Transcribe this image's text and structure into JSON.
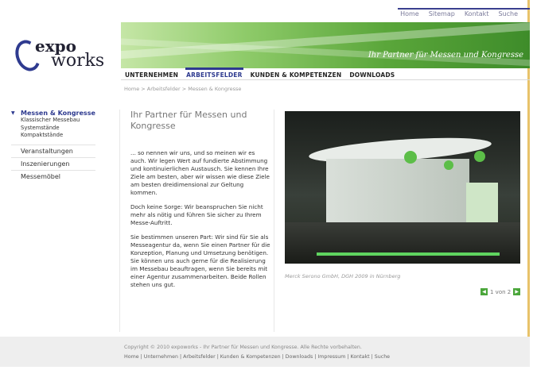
{
  "utility_nav": [
    "Home",
    "Sitemap",
    "Kontakt",
    "Suche"
  ],
  "logo": {
    "word1": "expo",
    "word2": "works"
  },
  "banner": {
    "slogan": "Ihr Partner für Messen und Kongresse"
  },
  "main_nav": [
    {
      "label": "UNTERNEHMEN",
      "active": false
    },
    {
      "label": "ARBEITSFELDER",
      "active": true
    },
    {
      "label": "KUNDEN & KOMPETENZEN",
      "active": false
    },
    {
      "label": "DOWNLOADS",
      "active": false
    }
  ],
  "breadcrumb": "Home > Arbeitsfelder > Messen & Kongresse",
  "sidebar": {
    "current": "Messen & Kongresse",
    "sub_items": [
      "Klassischer Messebau",
      "Systemstände",
      "Kompaktstände"
    ],
    "categories": [
      "Veranstaltungen",
      "Inszenierungen",
      "Messemöbel"
    ]
  },
  "content": {
    "heading": "Ihr Partner für Messen und Kongresse",
    "paragraphs": [
      "... so nennen wir uns, und so meinen wir es auch. Wir legen Wert auf fundierte Abstimmung und kontinuierlichen Austausch. Sie kennen Ihre Ziele am besten, aber wir wissen wie diese Ziele am besten dreidimensional zur Geltung kommen.",
      "Doch keine Sorge: Wir beanspruchen Sie nicht mehr als nötig und führen Sie sicher zu Ihrem Messe-Auftritt.",
      "Sie bestimmen unseren Part: Wir sind für Sie als Messeagentur da, wenn Sie einen Partner für die Konzeption, Planung und Umsetzung benötigen. Sie können uns auch gerne für die Realisierung im Messebau beauftragen, wenn Sie bereits mit einer Agentur zusammenarbeiten. Beide Rollen stehen uns gut."
    ]
  },
  "gallery": {
    "caption": "Merck Serono GmbH, DGH 2009 in Nürnberg",
    "pager_text": "1 von 2",
    "prev_glyph": "◀",
    "next_glyph": "▶"
  },
  "footer": {
    "copyright": "Copyright © 2010 expoworks - Ihr Partner für Messen und Kongresse. Alle Rechte vorbehalten.",
    "links": "Home | Unternehmen | Arbeitsfelder | Kunden & Kompetenzen | Downloads | Impressum | Kontakt | Suche"
  },
  "colors": {
    "brand_blue": "#2e3a8f",
    "accent_green": "#4aa63a"
  }
}
